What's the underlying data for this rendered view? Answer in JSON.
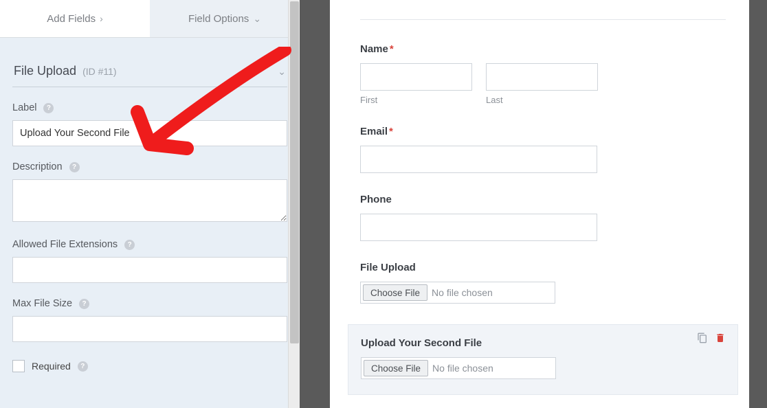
{
  "tabs": {
    "add_fields": "Add Fields",
    "field_options": "Field Options"
  },
  "section": {
    "title": "File Upload",
    "id_tag": "(ID #11)"
  },
  "labels": {
    "label": "Label",
    "description": "Description",
    "allowed_ext": "Allowed File Extensions",
    "max_size": "Max File Size",
    "required": "Required"
  },
  "values": {
    "label_input": "Upload Your Second File",
    "description_input": "",
    "allowed_ext_input": "",
    "max_size_input": ""
  },
  "form": {
    "name_label": "Name",
    "first_sub": "First",
    "last_sub": "Last",
    "email_label": "Email",
    "phone_label": "Phone",
    "file_upload_label": "File Upload",
    "choose_file": "Choose File",
    "no_file": "No file chosen",
    "second_file_label": "Upload Your Second File"
  }
}
